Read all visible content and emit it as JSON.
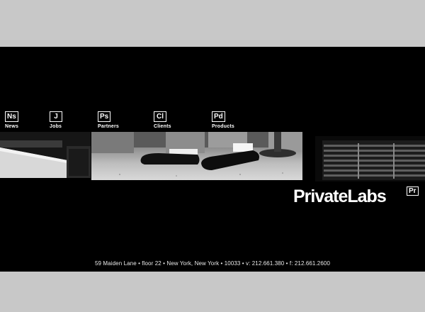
{
  "nav": {
    "items": [
      {
        "abbr": "Ns",
        "label": "News"
      },
      {
        "abbr": "J",
        "label": "Jobs"
      },
      {
        "abbr": "Ps",
        "label": "Partners"
      },
      {
        "abbr": "Cl",
        "label": "Clients"
      },
      {
        "abbr": "Pd",
        "label": "Products"
      }
    ]
  },
  "brand": {
    "name": "PrivateLabs",
    "badge": "Pr"
  },
  "footer": {
    "address": "59 Maiden Lane • floor 22 •  New York, New York • 10033 • v: 212.661.380 • f: 212.661.2600"
  },
  "colors": {
    "page_bg": "#c8c8c8",
    "stage_bg": "#000000",
    "text": "#ffffff"
  }
}
